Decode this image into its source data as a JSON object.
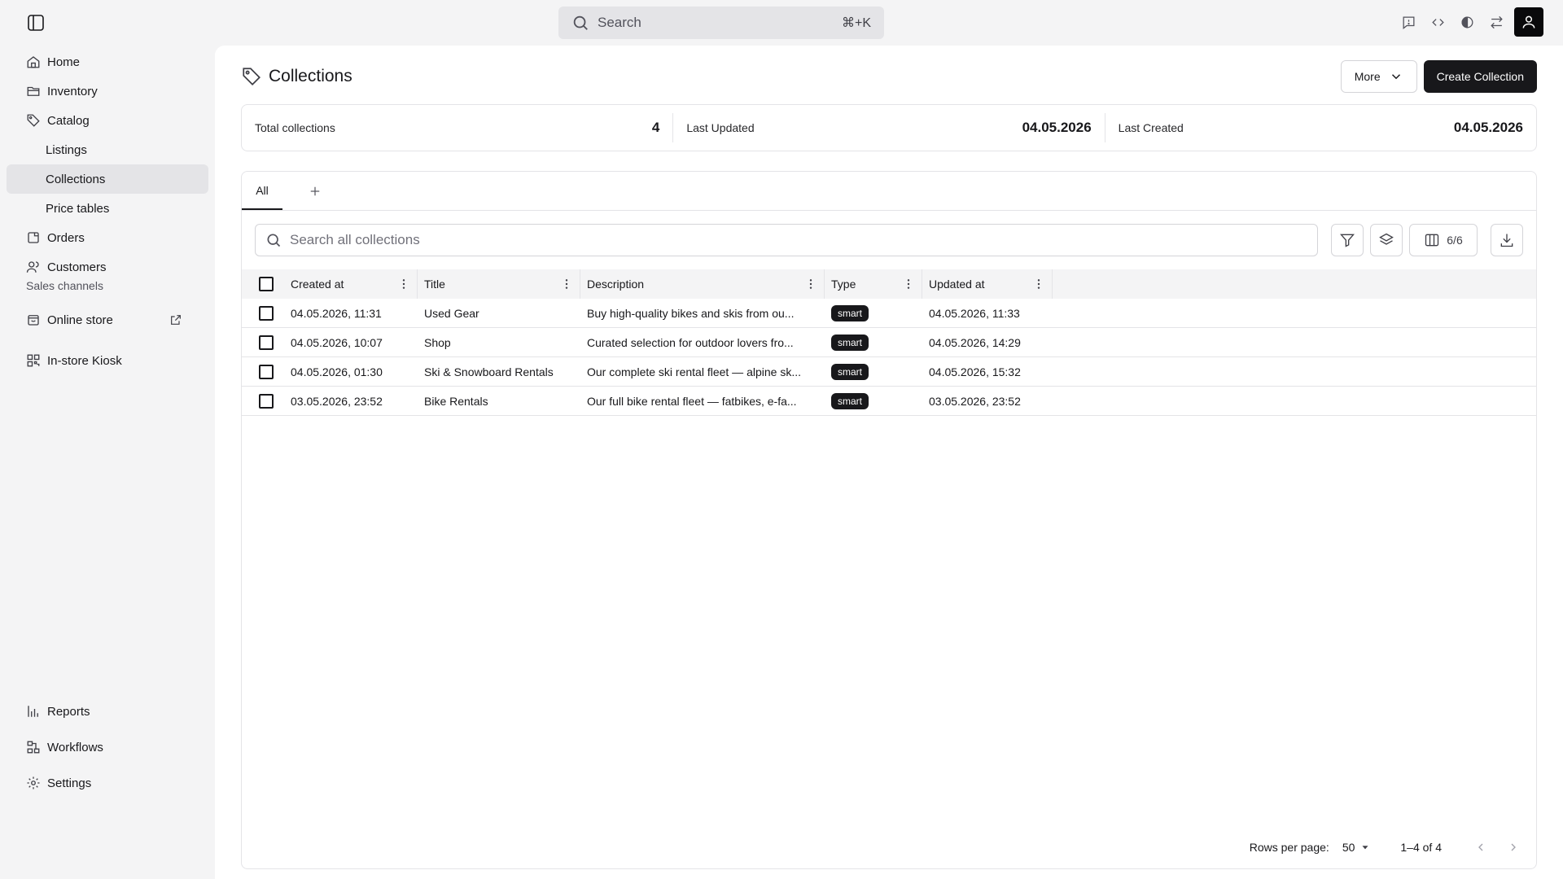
{
  "global_search": {
    "label": "Search",
    "shortcut": "⌘+K"
  },
  "sidebar": {
    "items": [
      {
        "label": "Home",
        "icon": "home-icon"
      },
      {
        "label": "Inventory",
        "icon": "folder-icon"
      },
      {
        "label": "Catalog",
        "icon": "tag-icon"
      },
      {
        "label": "Listings"
      },
      {
        "label": "Collections"
      },
      {
        "label": "Price tables"
      },
      {
        "label": "Orders",
        "icon": "orders-icon"
      },
      {
        "label": "Customers",
        "icon": "users-icon"
      }
    ],
    "section_label": "Sales channels",
    "channels": [
      {
        "label": "Online store",
        "icon": "store-icon"
      },
      {
        "label": "In-store Kiosk",
        "icon": "qr-icon"
      }
    ],
    "bottom": [
      {
        "label": "Reports",
        "icon": "chart-icon"
      },
      {
        "label": "Workflows",
        "icon": "workflow-icon"
      },
      {
        "label": "Settings",
        "icon": "gear-icon"
      }
    ]
  },
  "header": {
    "title": "Collections",
    "more_label": "More",
    "create_label": "Create Collection"
  },
  "stats": [
    {
      "label": "Total collections",
      "value": "4"
    },
    {
      "label": "Last Updated",
      "value": "04.05.2026"
    },
    {
      "label": "Last Created",
      "value": "04.05.2026"
    }
  ],
  "tabs": [
    {
      "label": "All"
    }
  ],
  "table": {
    "search_placeholder": "Search all collections",
    "columns_count": "6/6",
    "columns": [
      "Created at",
      "Title",
      "Description",
      "Type",
      "Updated at"
    ],
    "rows": [
      {
        "created": "04.05.2026, 11:31",
        "title": "Used Gear",
        "description": "Buy high-quality bikes and skis from ou...",
        "type": "smart",
        "updated": "04.05.2026, 11:33"
      },
      {
        "created": "04.05.2026, 10:07",
        "title": "Shop",
        "description": "Curated selection for outdoor lovers fro...",
        "type": "smart",
        "updated": "04.05.2026, 14:29"
      },
      {
        "created": "04.05.2026, 01:30",
        "title": "Ski & Snowboard Rentals",
        "description": "Our complete ski rental fleet — alpine sk...",
        "type": "smart",
        "updated": "04.05.2026, 15:32"
      },
      {
        "created": "03.05.2026, 23:52",
        "title": "Bike Rentals",
        "description": "Our full bike rental fleet — fatbikes, e-fa...",
        "type": "smart",
        "updated": "03.05.2026, 23:52"
      }
    ]
  },
  "pagination": {
    "rows_per_page_label": "Rows per page:",
    "rows_per_page": "50",
    "range": "1–4 of 4"
  }
}
